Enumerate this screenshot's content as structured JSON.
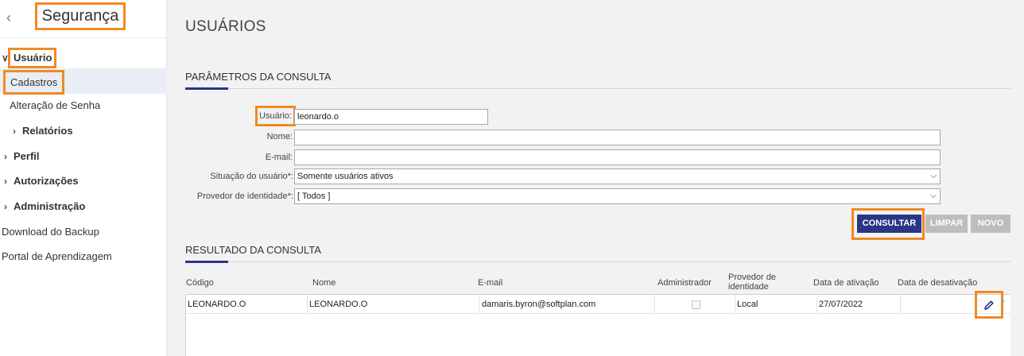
{
  "sidebar": {
    "title": "Segurança",
    "items": {
      "usuario": "Usuário",
      "cadastros": "Cadastros",
      "alteracao": "Alteração de Senha",
      "relatorios": "Relatórios",
      "perfil": "Perfil",
      "autorizacoes": "Autorizações",
      "administracao": "Administração",
      "download": "Download do Backup",
      "portal": "Portal de Aprendizagem"
    }
  },
  "page": {
    "title": "USUÁRIOS",
    "params_title": "PARÂMETROS DA CONSULTA",
    "results_title": "RESULTADO DA CONSULTA"
  },
  "form": {
    "usuario_label": "Usuário:",
    "usuario_value": "leonardo.o",
    "nome_label": "Nome:",
    "nome_value": "",
    "email_label": "E-mail:",
    "email_value": "",
    "situacao_label": "Situação do usuário*:",
    "situacao_value": "Somente usuários ativos",
    "provedor_label": "Provedor de identidade*:",
    "provedor_value": "[ Todos ]"
  },
  "buttons": {
    "consultar": "CONSULTAR",
    "limpar": "LIMPAR",
    "novo": "NOVO"
  },
  "table": {
    "headers": {
      "codigo": "Código",
      "nome": "Nome",
      "email": "E-mail",
      "administrador": "Administrador",
      "provedor_1": "Provedor de",
      "provedor_2": "identidade",
      "ativacao": "Data de ativação",
      "desativacao": "Data de desativação"
    },
    "rows": [
      {
        "codigo": "LEONARDO.O",
        "nome": "LEONARDO.O",
        "email": "damaris.byron@softplan.com",
        "administrador": false,
        "provedor": "Local",
        "ativacao": "27/07/2022",
        "desativacao": ""
      }
    ]
  },
  "colors": {
    "accent": "#2b3586",
    "highlight": "#f08a24",
    "selected_bg": "#e9eef6"
  },
  "icons": {
    "back": "chevron-left-icon",
    "edit": "pencil-icon"
  }
}
